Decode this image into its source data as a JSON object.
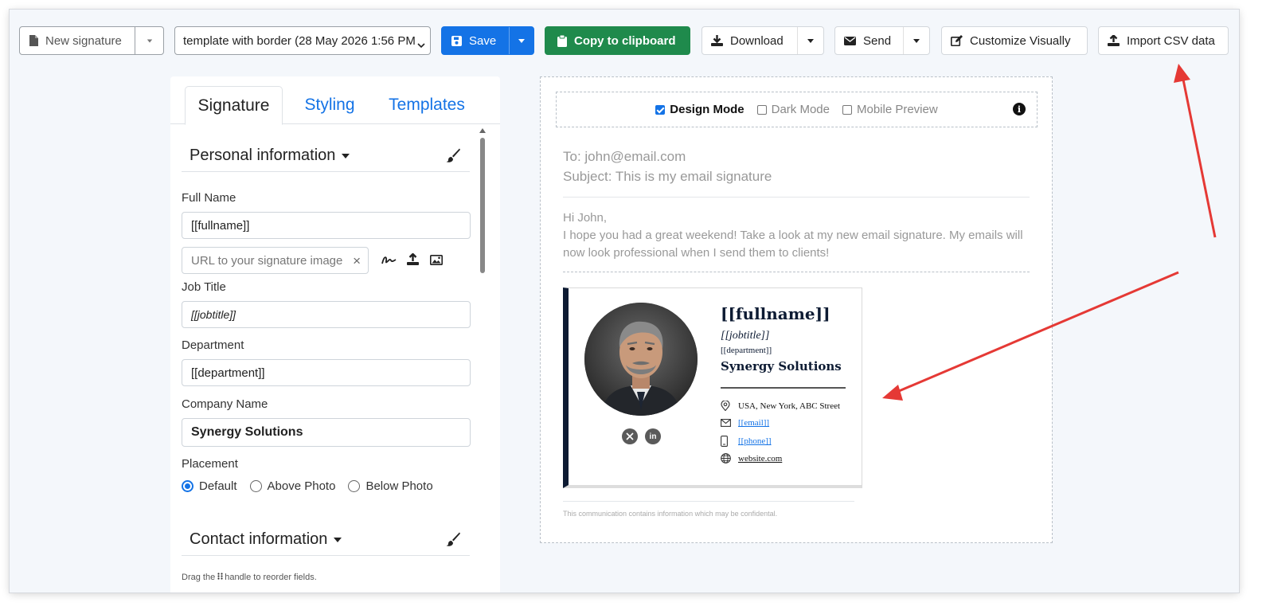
{
  "toolbar": {
    "new_signature": "New signature",
    "template_select": "template with border (28 May 2026 1:56 PM",
    "save": "Save",
    "copy": "Copy to clipboard",
    "download": "Download",
    "send": "Send",
    "customize": "Customize Visually",
    "import_csv": "Import CSV data"
  },
  "tabs": [
    "Signature",
    "Styling",
    "Templates"
  ],
  "form": {
    "personal_header": "Personal information",
    "full_name_label": "Full Name",
    "full_name_value": "[[fullname]]",
    "signature_image_placeholder": "URL to your signature image",
    "job_title_label": "Job Title",
    "job_title_value": "[[jobtitle]]",
    "department_label": "Department",
    "department_value": "[[department]]",
    "company_label": "Company Name",
    "company_value": "Synergy Solutions",
    "placement_label": "Placement",
    "placement_options": [
      "Default",
      "Above Photo",
      "Below Photo"
    ],
    "placement_selected": "Default",
    "contact_header": "Contact information",
    "drag_hint_prefix": "Drag the",
    "drag_hint_suffix": "handle to reorder fields."
  },
  "preview": {
    "design_mode": "Design Mode",
    "dark_mode": "Dark Mode",
    "mobile_preview": "Mobile Preview",
    "design_mode_checked": true,
    "to": "To: john@email.com",
    "subject": "Subject: This is my email signature",
    "greeting": "Hi John,",
    "body": "I hope you had a great weekend! Take a look at my new email signature. My emails will now look professional when I send them to clients!",
    "disclaimer": "This communication contains information which may be confidental."
  },
  "signature": {
    "name": "[[fullname]]",
    "title": "[[jobtitle]]",
    "department": "[[department]]",
    "company": "Synergy Solutions",
    "address": "USA, New York, ABC Street",
    "email": "[[email]]",
    "phone": "[[phone]]",
    "website": "website.com",
    "accent_color": "#0d1b33"
  },
  "colors": {
    "primary": "#1473e6",
    "success": "#1f8a4c",
    "annotation": "#e53935"
  }
}
